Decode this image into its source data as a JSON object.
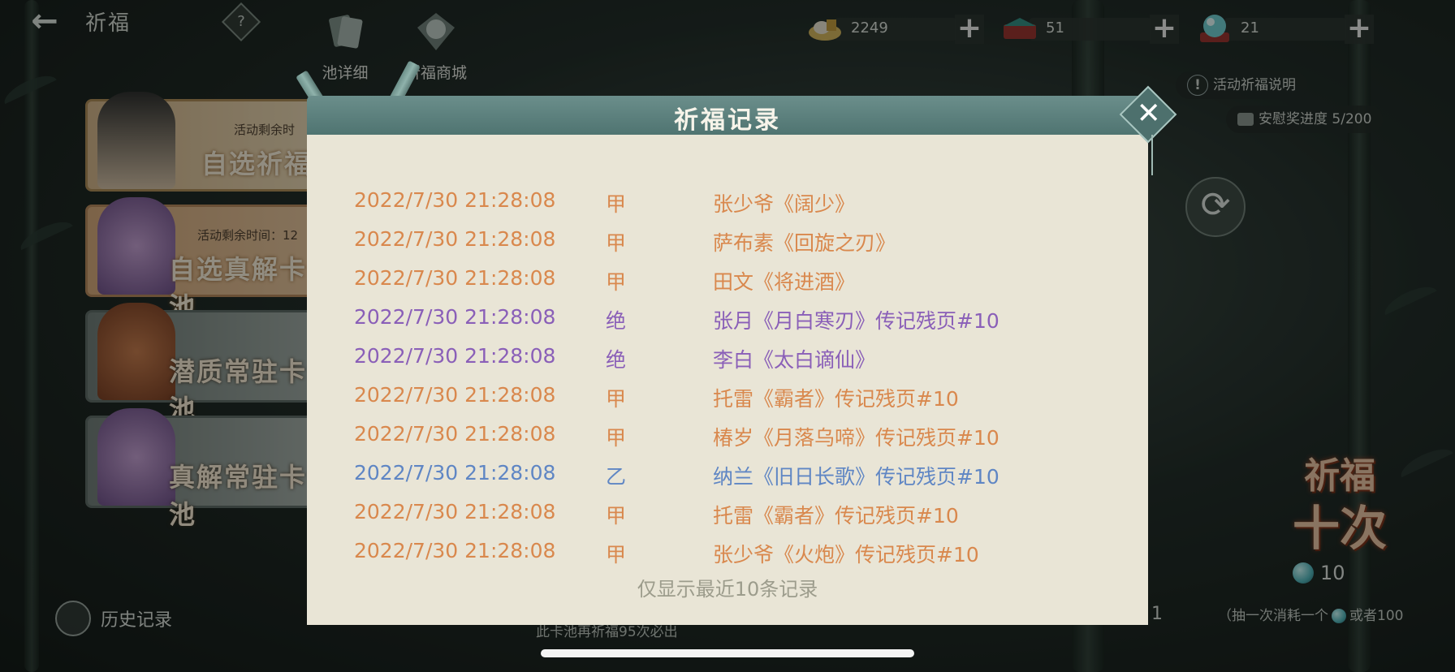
{
  "header": {
    "title": "祈福",
    "help_label": "?",
    "back_icon": "back-arrow-icon",
    "tabs": [
      {
        "label": "池详细",
        "icon": "cards-icon"
      },
      {
        "label": "祈福商城",
        "icon": "orb-shop-icon"
      }
    ]
  },
  "currencies": [
    {
      "icon": "silver-ingot-icon",
      "value": "2249"
    },
    {
      "icon": "treasure-box-icon",
      "value": "51"
    },
    {
      "icon": "jade-orb-icon",
      "value": "21"
    }
  ],
  "right_panel": {
    "event_info": "活动祈福说明",
    "consolation": "安慰奖进度 5/200",
    "draw_ten_line1": "祈福",
    "draw_ten_line2": "十次",
    "draw_ten_cost": "10",
    "cost_note": "（抽一次消耗一个",
    "cost_note_tail": "或者100",
    "counter": "1"
  },
  "banners": [
    {
      "name": "自选祈福",
      "sub": "活动剩余时"
    },
    {
      "name": "自选真解卡池",
      "sub": "活动剩余时间：12"
    },
    {
      "name": "潜质常驻卡池",
      "sub": ""
    },
    {
      "name": "真解常驻卡池",
      "sub": ""
    }
  ],
  "history_label": "历史记录",
  "bottom_note": "此卡池再祈福95次必出",
  "modal": {
    "title": "祈福记录",
    "footnote": "仅显示最近10条记录",
    "records": [
      {
        "time": "2022/7/30 21:28:08",
        "rank": "甲",
        "name": "张少爷《阔少》",
        "cls": "jia"
      },
      {
        "time": "2022/7/30 21:28:08",
        "rank": "甲",
        "name": "萨布素《回旋之刃》",
        "cls": "jia"
      },
      {
        "time": "2022/7/30 21:28:08",
        "rank": "甲",
        "name": "田文《将进酒》",
        "cls": "jia"
      },
      {
        "time": "2022/7/30 21:28:08",
        "rank": "绝",
        "name": "张月《月白寒刃》传记残页#10",
        "cls": "jue"
      },
      {
        "time": "2022/7/30 21:28:08",
        "rank": "绝",
        "name": "李白《太白谪仙》",
        "cls": "jue"
      },
      {
        "time": "2022/7/30 21:28:08",
        "rank": "甲",
        "name": "托雷《霸者》传记残页#10",
        "cls": "jia"
      },
      {
        "time": "2022/7/30 21:28:08",
        "rank": "甲",
        "name": "椿岁《月落乌啼》传记残页#10",
        "cls": "jia"
      },
      {
        "time": "2022/7/30 21:28:08",
        "rank": "乙",
        "name": "纳兰《旧日长歌》传记残页#10",
        "cls": "yi"
      },
      {
        "time": "2022/7/30 21:28:08",
        "rank": "甲",
        "name": "托雷《霸者》传记残页#10",
        "cls": "jia"
      },
      {
        "time": "2022/7/30 21:28:08",
        "rank": "甲",
        "name": "张少爷《火炮》传记残页#10",
        "cls": "jia"
      }
    ]
  },
  "colors": {
    "rank_jia": "#d9884d",
    "rank_jue": "#8a5fb8",
    "rank_yi": "#5f86c4",
    "modal_bg": "#e9e5d6",
    "header_bg": "#5a7e7b"
  }
}
